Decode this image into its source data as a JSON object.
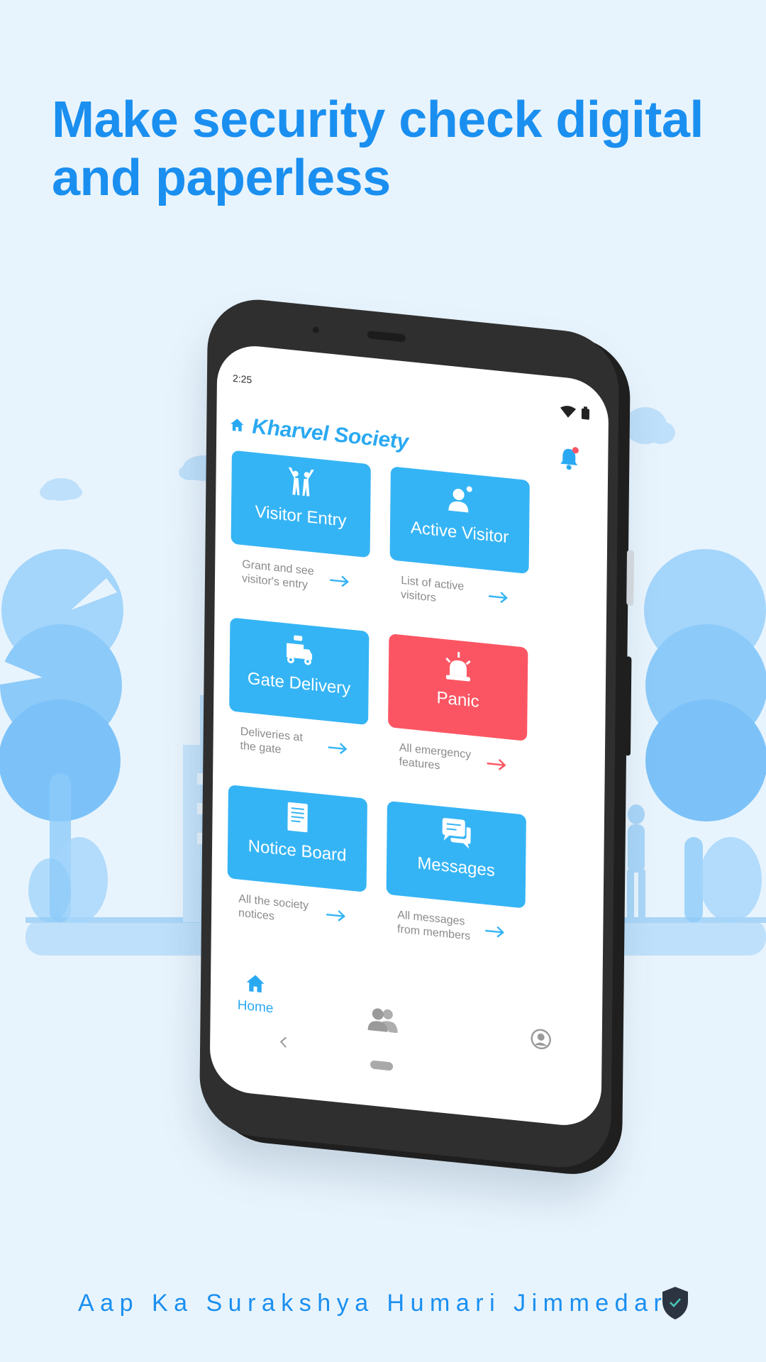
{
  "headline": {
    "line1": "Make security check digital",
    "line2": "and paperless"
  },
  "tagline": "Aap Ka Surakshya Humari Jimmedari",
  "colors": {
    "accent": "#1a8ff0",
    "tile_blue": "#35b4f5",
    "tile_red": "#fb5563",
    "background": "#e8f4fd"
  },
  "phone": {
    "status": {
      "time": "2:25",
      "icons": [
        "wifi-icon",
        "battery-icon"
      ]
    },
    "header": {
      "icon": "home-icon",
      "title": "Kharvel Society",
      "bell_icon": "bell-icon"
    },
    "tiles": [
      {
        "label": "Visitor Entry",
        "icon": "people-cheer-icon",
        "description_1": "Grant and see",
        "description_2": "visitor's entry",
        "color": "blue"
      },
      {
        "label": "Active Visitor",
        "icon": "person-active-icon",
        "description_1": "List of active",
        "description_2": "visitors",
        "color": "blue"
      },
      {
        "label": "Gate Delivery",
        "icon": "delivery-truck-icon",
        "description_1": "Deliveries at",
        "description_2": "the gate",
        "color": "blue"
      },
      {
        "label": "Panic",
        "icon": "siren-icon",
        "description_1": "All emergency",
        "description_2": "features",
        "color": "red"
      },
      {
        "label": "Notice Board",
        "icon": "document-icon",
        "description_1": "All the society",
        "description_2": "notices",
        "color": "blue"
      },
      {
        "label": "Messages",
        "icon": "chat-bubbles-icon",
        "description_1": "All messages",
        "description_2": "from members",
        "color": "blue"
      }
    ],
    "nav": {
      "home_label": "Home",
      "items": [
        "home-icon",
        "members-icon",
        "profile-icon"
      ]
    }
  }
}
